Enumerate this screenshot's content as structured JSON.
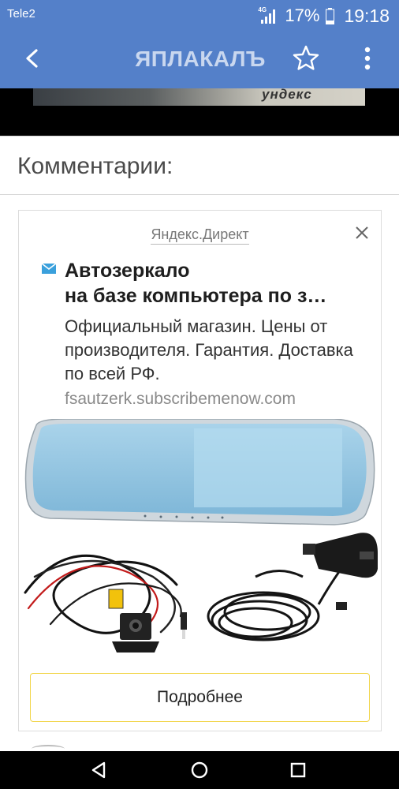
{
  "status_bar": {
    "carrier": "Tele2",
    "network": "4G",
    "battery_percent": "17%",
    "time": "19:18",
    "icons": [
      "signal-icon",
      "battery-icon"
    ]
  },
  "app_bar": {
    "logo_text": "ЯПЛАКАЛЪ",
    "icons": [
      "back-arrow-icon",
      "star-icon",
      "more-vert-icon"
    ],
    "color": "#5480c9"
  },
  "top_image": {
    "visible_text": "ундекс"
  },
  "comments": {
    "title": "Комментарии:"
  },
  "ad": {
    "provider": "Яндекс.Директ",
    "headline_line1": "Автозеркало",
    "headline_line2": "на базе компьютера по з…",
    "description": "Официальный магазин. Цены от производителя. Гарантия. Доставка по всей РФ.",
    "url": "fsautzerk.subscribemenow.com",
    "button_label": "Подробнее",
    "button_border_color": "#f1d54a",
    "icons": [
      "close-icon",
      "mail-icon"
    ]
  },
  "nav_bar": {
    "icons": [
      "back-triangle-icon",
      "home-circle-icon",
      "recents-square-icon"
    ]
  }
}
